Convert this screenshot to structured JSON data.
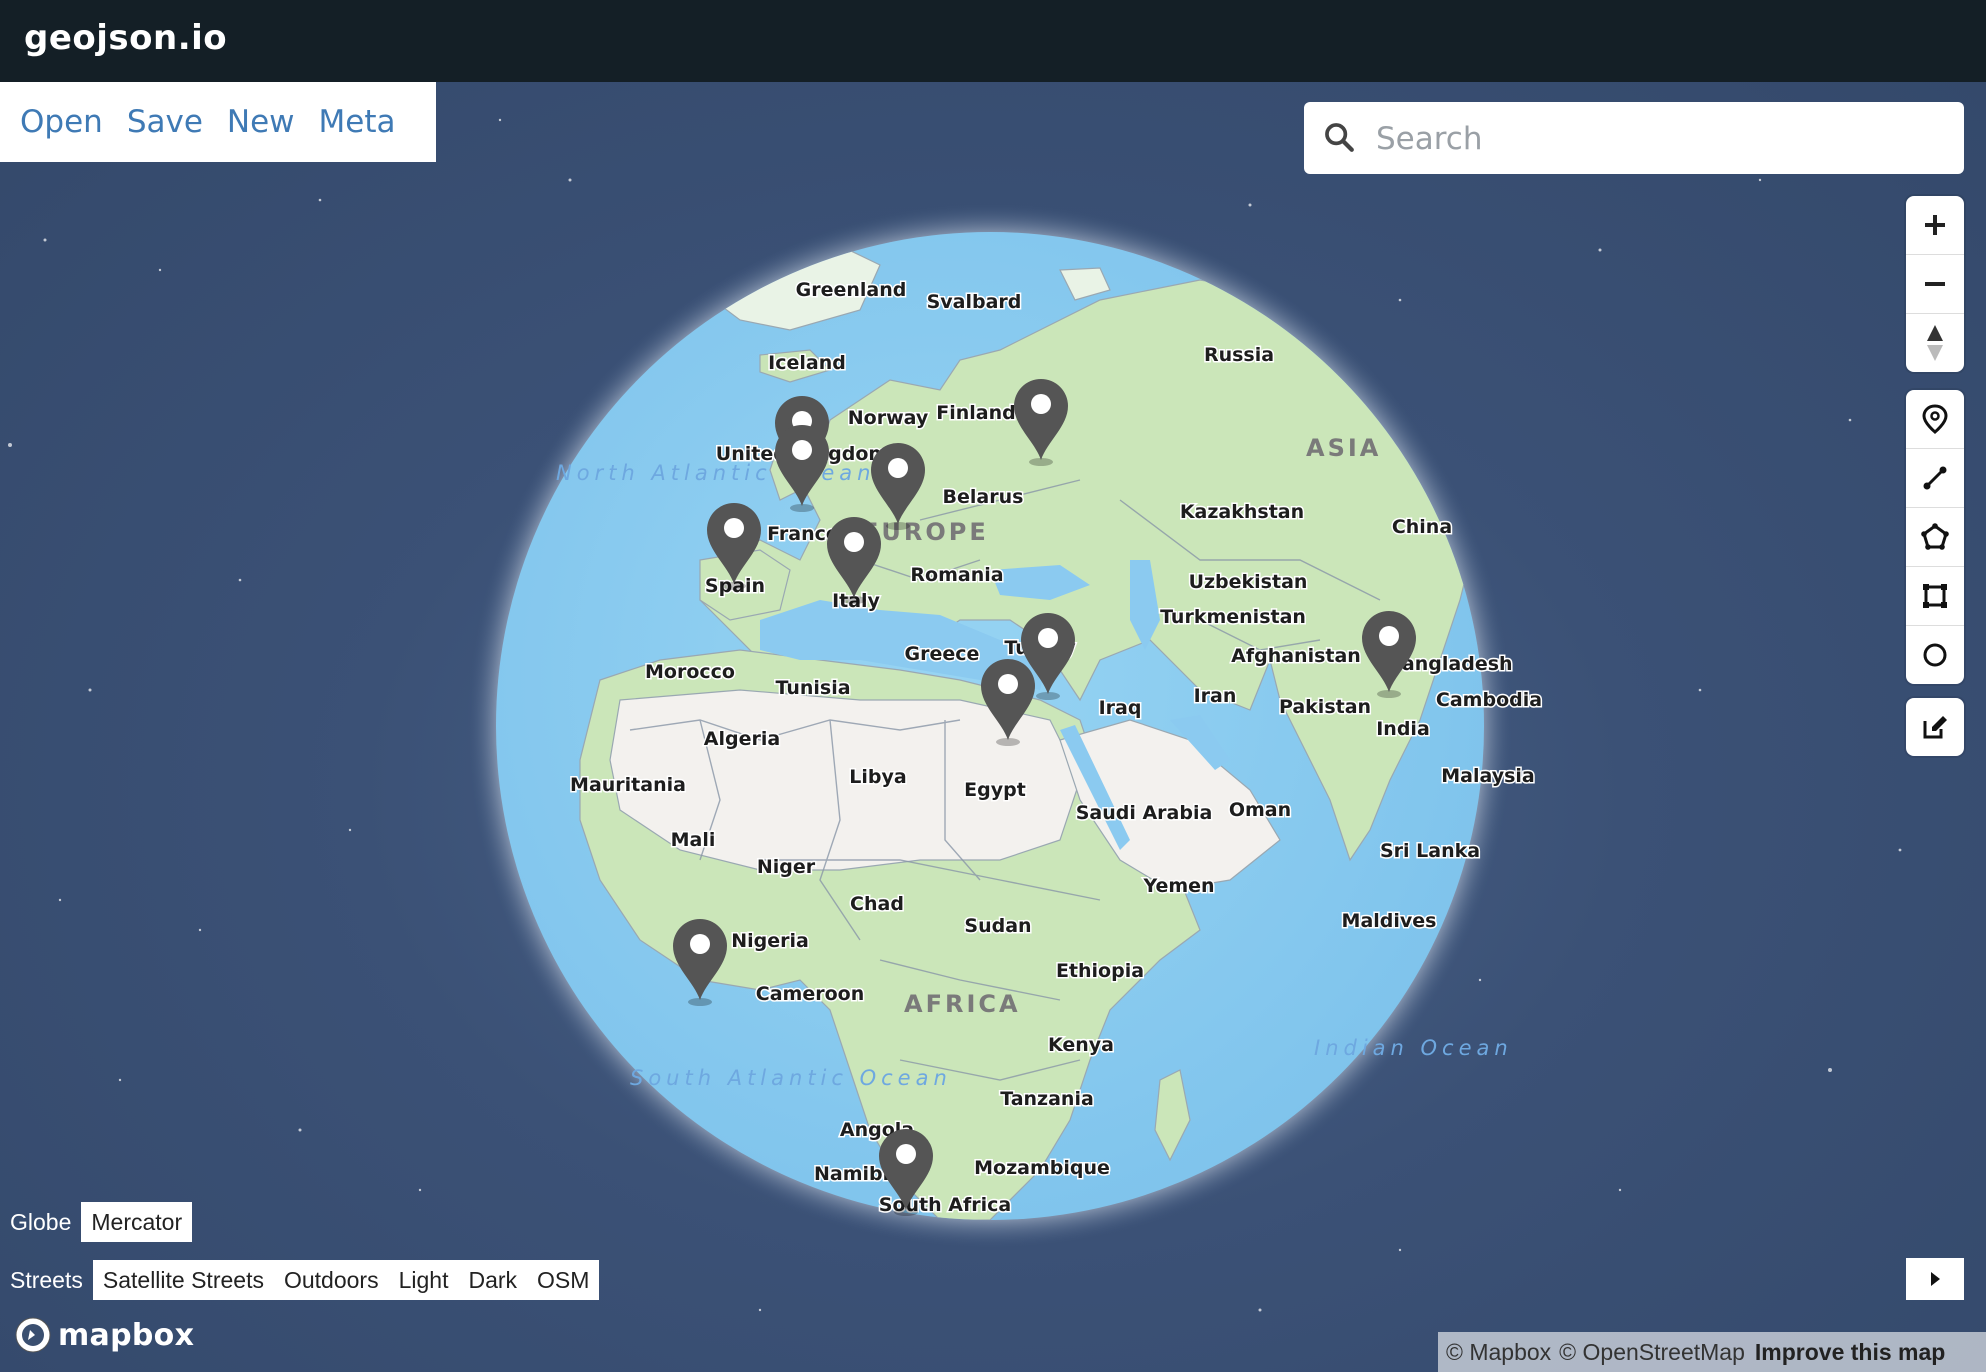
{
  "app": {
    "title": "geojson.io"
  },
  "file_menu": [
    "Open",
    "Save",
    "New",
    "Meta"
  ],
  "search": {
    "placeholder": "Search",
    "value": ""
  },
  "map_controls": {
    "nav": [
      "zoom-in",
      "zoom-out",
      "compass"
    ],
    "draw": [
      "point",
      "line",
      "polygon",
      "rectangle",
      "circle"
    ],
    "edit": [
      "edit"
    ]
  },
  "projection": {
    "options": [
      "Globe",
      "Mercator"
    ],
    "selected": "Globe"
  },
  "map_styles": {
    "options": [
      "Streets",
      "Satellite Streets",
      "Outdoors",
      "Light",
      "Dark",
      "OSM"
    ],
    "selected": "Streets"
  },
  "logo": {
    "text": "mapbox"
  },
  "attribution": {
    "mapbox": "© Mapbox",
    "osm": "© OpenStreetMap",
    "improve": "Improve this map"
  },
  "map_labels": {
    "countries": [
      "Greenland",
      "Svalbard",
      "Iceland",
      "Russia",
      "Norway",
      "Finland",
      "United Kingdom",
      "Belarus",
      "France",
      "Kazakhstan",
      "China",
      "Spain",
      "Italy",
      "Romania",
      "Uzbekistan",
      "Turkmenistan",
      "Greece",
      "Turkey",
      "Afghanistan",
      "Bangladesh",
      "Morocco",
      "Tunisia",
      "Iran",
      "Pakistan",
      "Cambodia",
      "India",
      "Algeria",
      "Iraq",
      "Libya",
      "Egypt",
      "Mauritania",
      "Saudi Arabia",
      "Oman",
      "Malaysia",
      "Mali",
      "Niger",
      "Sri Lanka",
      "Chad",
      "Yemen",
      "Sudan",
      "Maldives",
      "Nigeria",
      "Ethiopia",
      "Cameroon",
      "Kenya",
      "Tanzania",
      "Angola",
      "Mozambique",
      "Namibia",
      "South Africa"
    ],
    "continents": [
      "ASIA",
      "EUROPE",
      "AFRICA"
    ],
    "oceans": [
      "North Atlantic Ocean",
      "South Atlantic Ocean",
      "Indian Ocean"
    ]
  },
  "markers": [
    {
      "name": "United Kingdom"
    },
    {
      "name": "United Kingdom 2"
    },
    {
      "name": "Russia"
    },
    {
      "name": "Germany"
    },
    {
      "name": "Spain"
    },
    {
      "name": "Italy"
    },
    {
      "name": "Turkey"
    },
    {
      "name": "Egypt"
    },
    {
      "name": "India"
    },
    {
      "name": "Gulf of Guinea"
    },
    {
      "name": "South Africa"
    }
  ],
  "colors": {
    "topbar": "#141f26",
    "link": "#3f7ab5",
    "space": "#3a4f70",
    "ocean": "#8fcff0",
    "land": "#c9e4b7",
    "desert": "#f2f0ec",
    "marker": "#555555"
  }
}
